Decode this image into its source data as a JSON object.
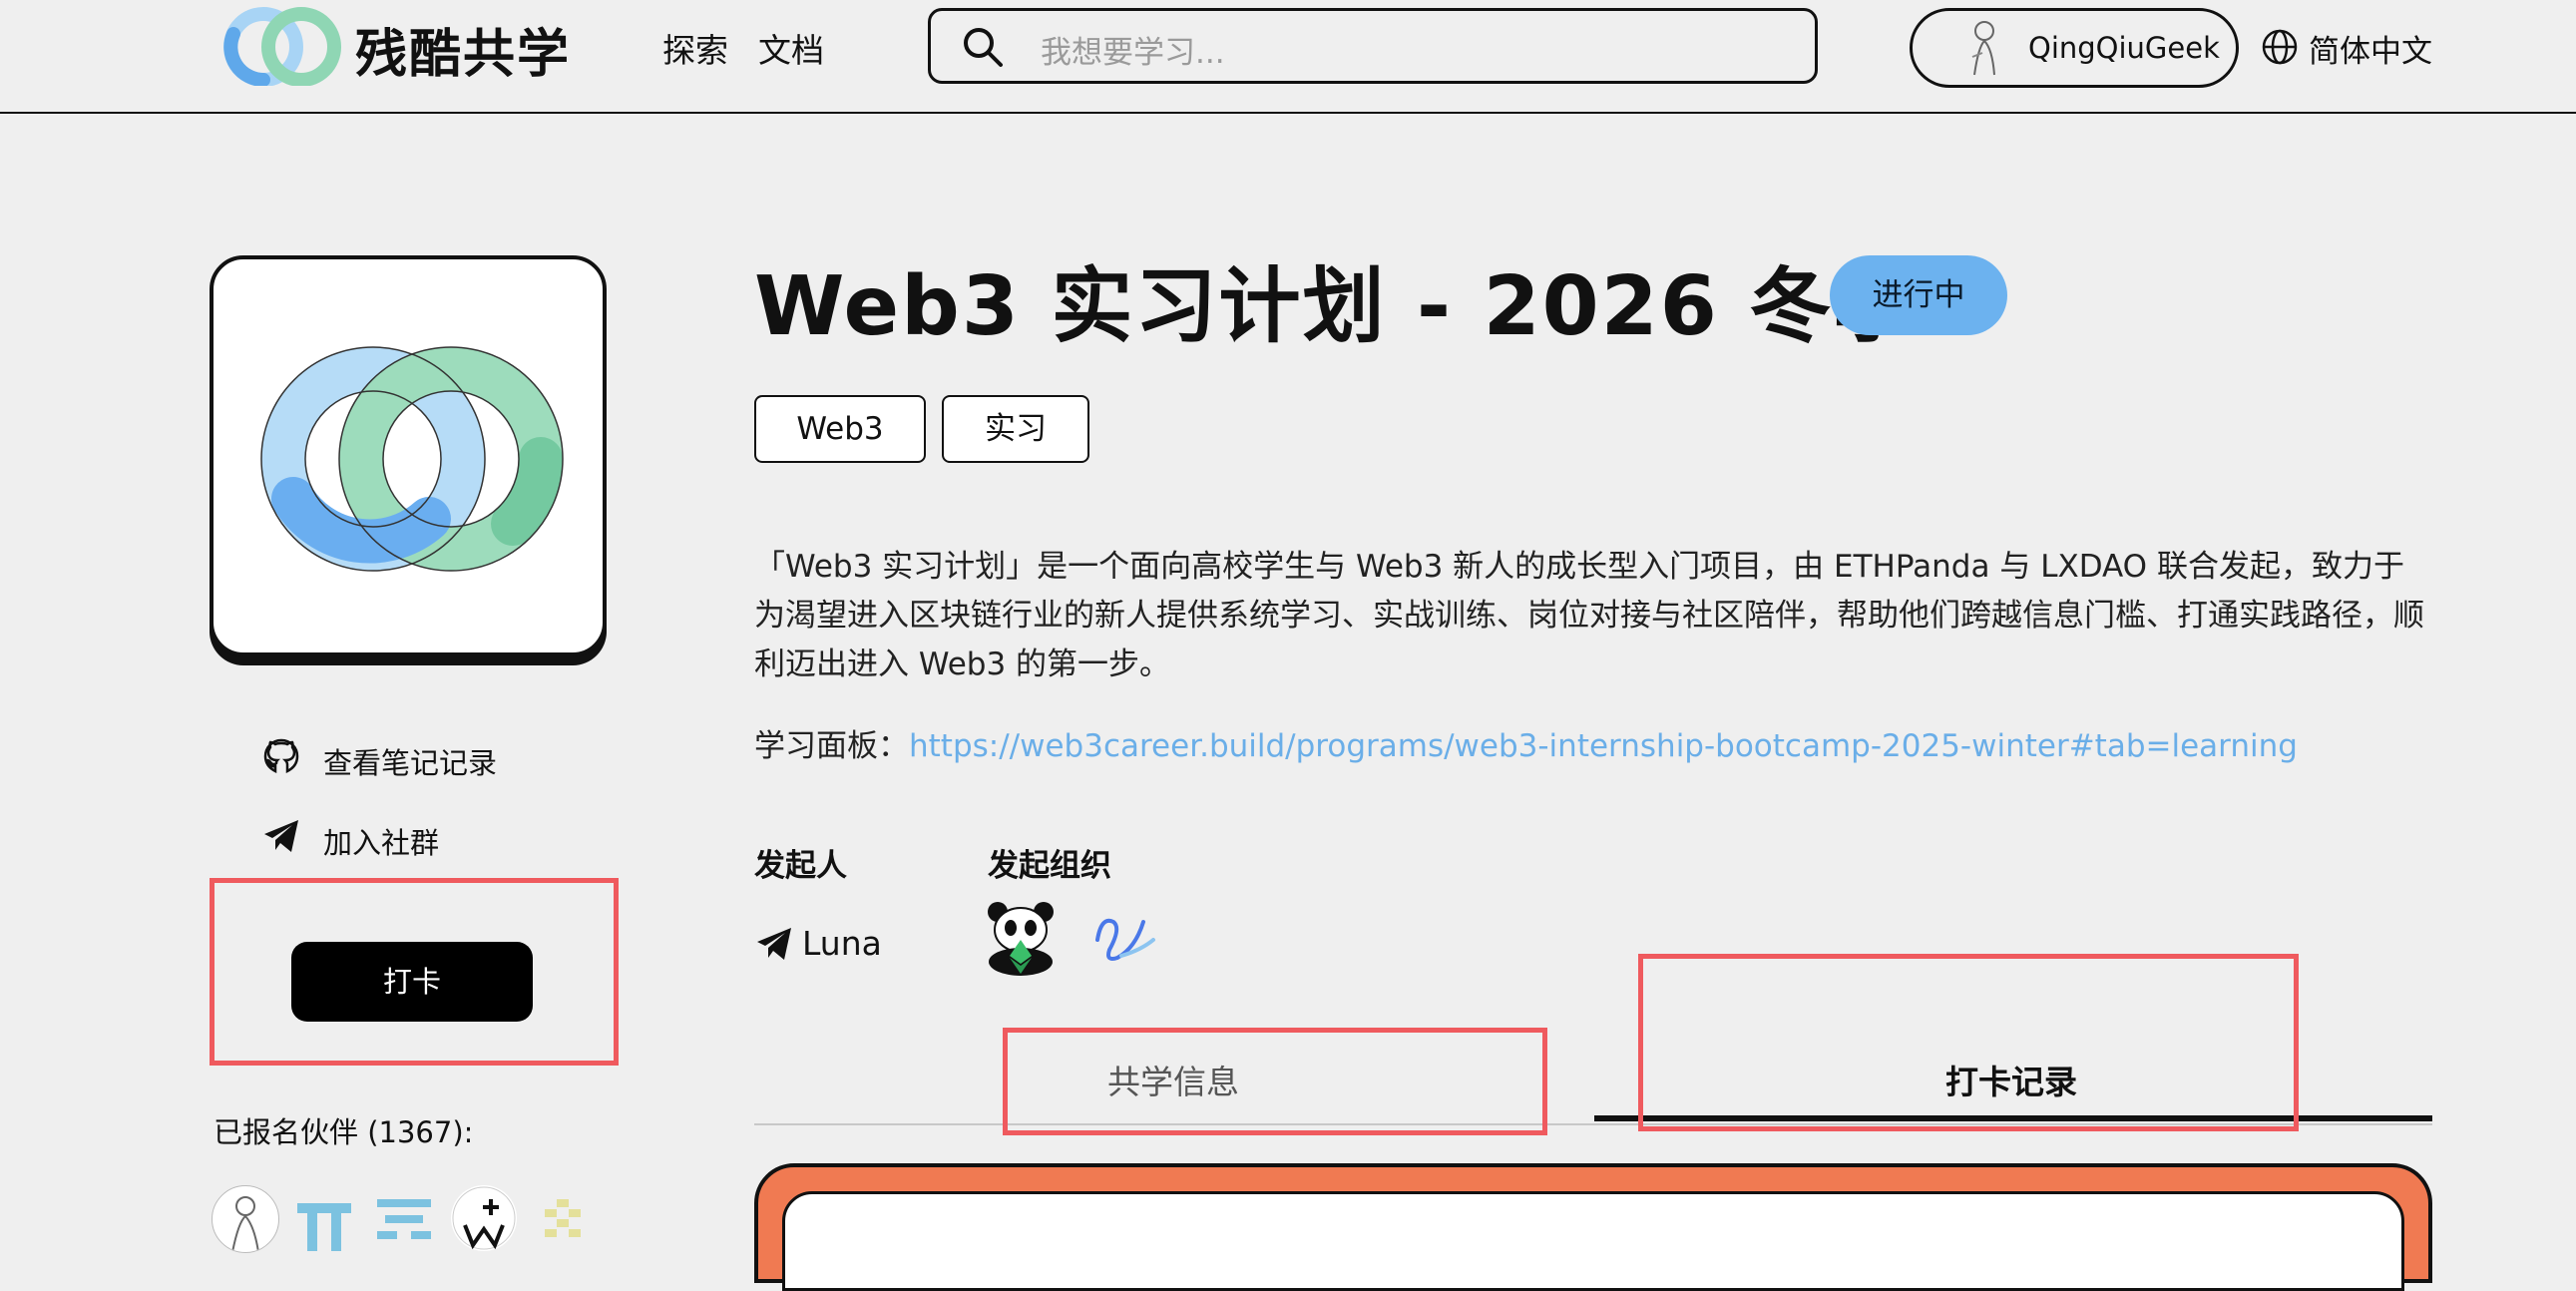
{
  "header": {
    "brand": "残酷共学",
    "nav": [
      "探索",
      "文档"
    ],
    "search_placeholder": "我想要学习...",
    "user_name": "QingQiuGeek",
    "language": "简体中文"
  },
  "sidebar": {
    "links": [
      {
        "label": "查看笔记记录",
        "icon": "github-icon"
      },
      {
        "label": "加入社群",
        "icon": "telegram-icon"
      }
    ],
    "checkin_label": "打卡",
    "members_label": "已报名伙伴 (1367):"
  },
  "program": {
    "title": "Web3 实习计划 - 2026 冬季",
    "status": "进行中",
    "tags": [
      "Web3",
      "实习"
    ],
    "description": "「Web3 实习计划」是一个面向高校学生与 Web3 新人的成长型入门项目，由 ETHPanda 与 LXDAO 联合发起，致力于为渴望进入区块链行业的新人提供系统学习、实战训练、岗位对接与社区陪伴，帮助他们跨越信息门槛、打通实践路径，顺利迈出进入 Web3 的第一步。",
    "board_label": "学习面板：",
    "board_url": "https://web3career.build/programs/web3-internship-bootcamp-2025-winter#tab=learning",
    "initiator_heading": "发起人",
    "initiator_name": "Luna",
    "org_heading": "发起组织"
  },
  "tabs": [
    {
      "label": "共学信息",
      "active": false
    },
    {
      "label": "打卡记录",
      "active": true
    }
  ],
  "colors": {
    "accent_blue": "#6cb2ef",
    "link_blue": "#6aaee8",
    "highlight_red": "#ef5a5e",
    "card_orange": "#f07a52"
  }
}
